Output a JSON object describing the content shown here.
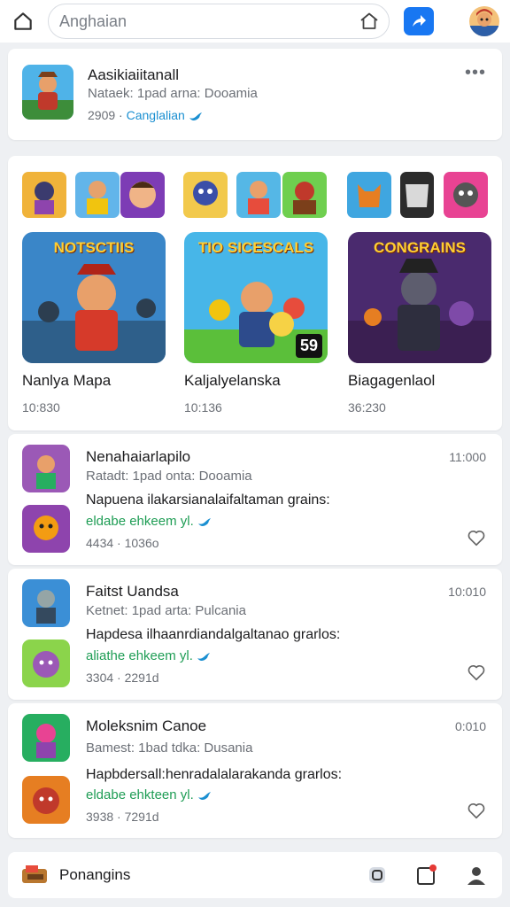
{
  "search": {
    "value": "Anghaian"
  },
  "profile": {
    "title": "Aasikiaiitanall",
    "subtitle": "Nataek: 1pad arna: Dooamia",
    "count": "2909",
    "link": "Canglalian"
  },
  "featured": [
    {
      "title": "Nanlya Mapa",
      "count": "10:830",
      "banner": "NOTSCTIIS"
    },
    {
      "title": "Kaljalyelanska",
      "count": "10:136",
      "banner": "TIO SICESCALS",
      "badge": "59"
    },
    {
      "title": "Biagagenlaol",
      "count": "36:230",
      "banner": "CONGRAINS"
    }
  ],
  "list": [
    {
      "title": "Nenahaiarlapilo",
      "time": "11:000",
      "meta": "Ratadt: 1pad onta: Dooamia",
      "desc": "Napuena ilakarsianalaifaltaman grains:",
      "tagline": "eldabe ehkeem yl.",
      "stats": "4434 · 1036o"
    },
    {
      "title": "Faitst Uandsa",
      "time": "10:010",
      "meta": "Ketnet: 1pad arta: Pulcania",
      "desc": "Hapdesa ilhaanrdiandalgaltanao grarlos:",
      "tagline": "aliathe ehkeem yl.",
      "stats": "3304 · 2291d"
    },
    {
      "title": "Moleksnim Canoe",
      "time": "0:010",
      "meta": "Bamest: 1bad tdka: Dusania",
      "desc": "Hapbdersall:henradalalarakanda grarlos:",
      "tagline": "eldabe ehkteen yl.",
      "stats": "3938 · 7291d"
    }
  ],
  "bottom": {
    "label": "Ponangins"
  },
  "colors": {
    "accent": "#1877f2",
    "link": "#1a8fd1",
    "green": "#1f9d55",
    "notification": "#e53935"
  }
}
